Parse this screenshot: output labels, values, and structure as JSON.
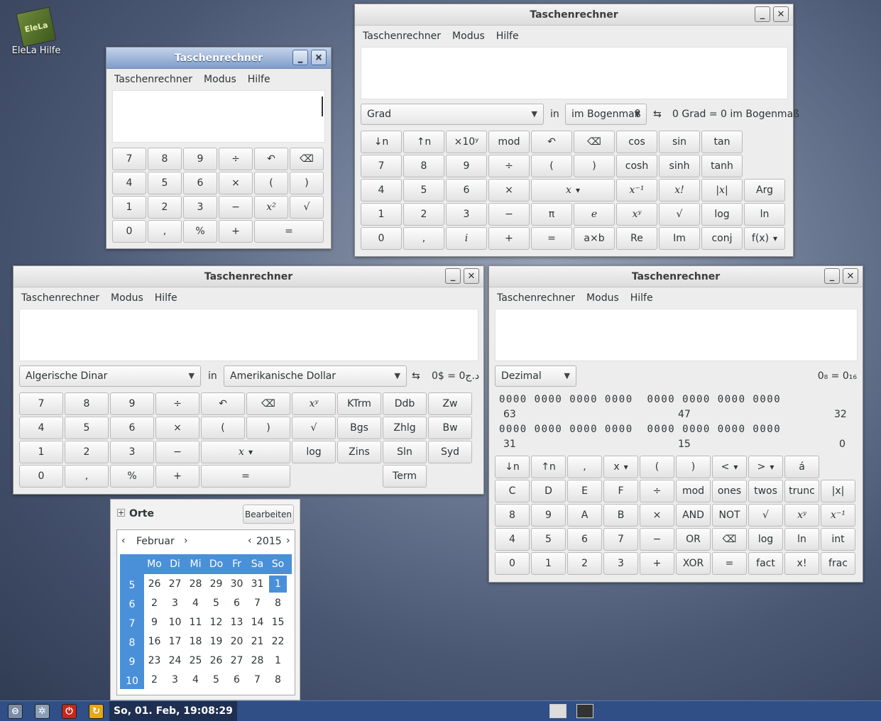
{
  "desktop": {
    "icon_label": "EleLa Hilfe",
    "icon_text": "EleLa"
  },
  "w1": {
    "title": "Taschenrechner",
    "menu": [
      "Taschenrechner",
      "Modus",
      "Hilfe"
    ],
    "keys": [
      "7",
      "8",
      "9",
      "÷",
      "↶",
      "⌫",
      "4",
      "5",
      "6",
      "×",
      "(",
      ")",
      "1",
      "2",
      "3",
      "−",
      "x²",
      "√",
      "0",
      ",",
      "%",
      "+",
      "="
    ]
  },
  "w2": {
    "title": "Taschenrechner",
    "menu": [
      "Taschenrechner",
      "Modus",
      "Hilfe"
    ],
    "from_unit": "Grad",
    "in_label": "in",
    "to_unit": "im Bogenmaß",
    "swap": "⇆",
    "result": "0 Grad = 0 im Bogenmaß",
    "keys": [
      "↓n",
      "↑n",
      "×10ʸ",
      "mod",
      "↶",
      "⌫",
      "cos",
      "sin",
      "tan",
      "7",
      "8",
      "9",
      "÷",
      "(",
      ")",
      "cosh",
      "sinh",
      "tanh",
      "4",
      "5",
      "6",
      "×",
      "x",
      "x⁻¹",
      "x!",
      "|x|",
      "Arg",
      "1",
      "2",
      "3",
      "−",
      "π",
      "e",
      "xʸ",
      "√",
      "log",
      "ln",
      "0",
      ",",
      "i",
      "+",
      "=",
      "a×b",
      "Re",
      "Im",
      "conj",
      "f(x)"
    ]
  },
  "w3": {
    "title": "Taschenrechner",
    "menu": [
      "Taschenrechner",
      "Modus",
      "Hilfe"
    ],
    "from_unit": "Algerische Dinar",
    "in_label": "in",
    "to_unit": "Amerikanische Dollar",
    "swap": "⇆",
    "result": "0$ = 0د.ج",
    "keys": [
      "7",
      "8",
      "9",
      "÷",
      "↶",
      "⌫",
      "xʸ",
      "KTrm",
      "Ddb",
      "Zw",
      "4",
      "5",
      "6",
      "×",
      "(",
      ")",
      "√",
      "Bgs",
      "Zhlg",
      "Bw",
      "1",
      "2",
      "3",
      "−",
      "x",
      "log",
      "Zins",
      "Sln",
      "Syd",
      "0",
      ",",
      "%",
      "+",
      "=",
      "Term"
    ]
  },
  "w4": {
    "title": "Taschenrechner",
    "menu": [
      "Taschenrechner",
      "Modus",
      "Hilfe"
    ],
    "base": "Dezimal",
    "conversion": "0₈ = 0₁₆",
    "bits_row1": "0000 0000 0000 0000  0000 0000 0000 0000",
    "bits_row2": "0000 0000 0000 0000  0000 0000 0000 0000",
    "pos": [
      "63",
      "47",
      "32",
      "31",
      "15",
      "0"
    ],
    "keys": [
      "↓n",
      "↑n",
      ",",
      "x",
      "(",
      ")",
      "<",
      ">",
      "á",
      "C",
      "D",
      "E",
      "F",
      "÷",
      "mod",
      "ones",
      "twos",
      "trunc",
      "|x|",
      "8",
      "9",
      "A",
      "B",
      "×",
      "AND",
      "NOT",
      "√",
      "xʸ",
      "x⁻¹",
      "4",
      "5",
      "6",
      "7",
      "−",
      "OR",
      "⌫",
      "log",
      "ln",
      "int",
      "0",
      "1",
      "2",
      "3",
      "+",
      "XOR",
      "=",
      "fact",
      "x!",
      "frac"
    ]
  },
  "places": {
    "title": "Orte",
    "edit_button": "Bearbeiten"
  },
  "calendar": {
    "month": "Februar",
    "year": "2015",
    "weekdays": [
      "Mo",
      "Di",
      "Mi",
      "Do",
      "Fr",
      "Sa",
      "So"
    ],
    "weeks": [
      {
        "wk": "5",
        "days": [
          "26",
          "27",
          "28",
          "29",
          "30",
          "31",
          "1"
        ]
      },
      {
        "wk": "6",
        "days": [
          "2",
          "3",
          "4",
          "5",
          "6",
          "7",
          "8"
        ]
      },
      {
        "wk": "7",
        "days": [
          "9",
          "10",
          "11",
          "12",
          "13",
          "14",
          "15"
        ]
      },
      {
        "wk": "8",
        "days": [
          "16",
          "17",
          "18",
          "19",
          "20",
          "21",
          "22"
        ]
      },
      {
        "wk": "9",
        "days": [
          "23",
          "24",
          "25",
          "26",
          "27",
          "28",
          "1"
        ]
      },
      {
        "wk": "10",
        "days": [
          "2",
          "3",
          "4",
          "5",
          "6",
          "7",
          "8"
        ]
      }
    ]
  },
  "taskbar": {
    "clock": "So, 01. Feb, 19:08:29"
  },
  "colors": {
    "accent": "#4a90d9",
    "taskbar": "#2f4f86",
    "active_title": "#7f9dc9"
  }
}
